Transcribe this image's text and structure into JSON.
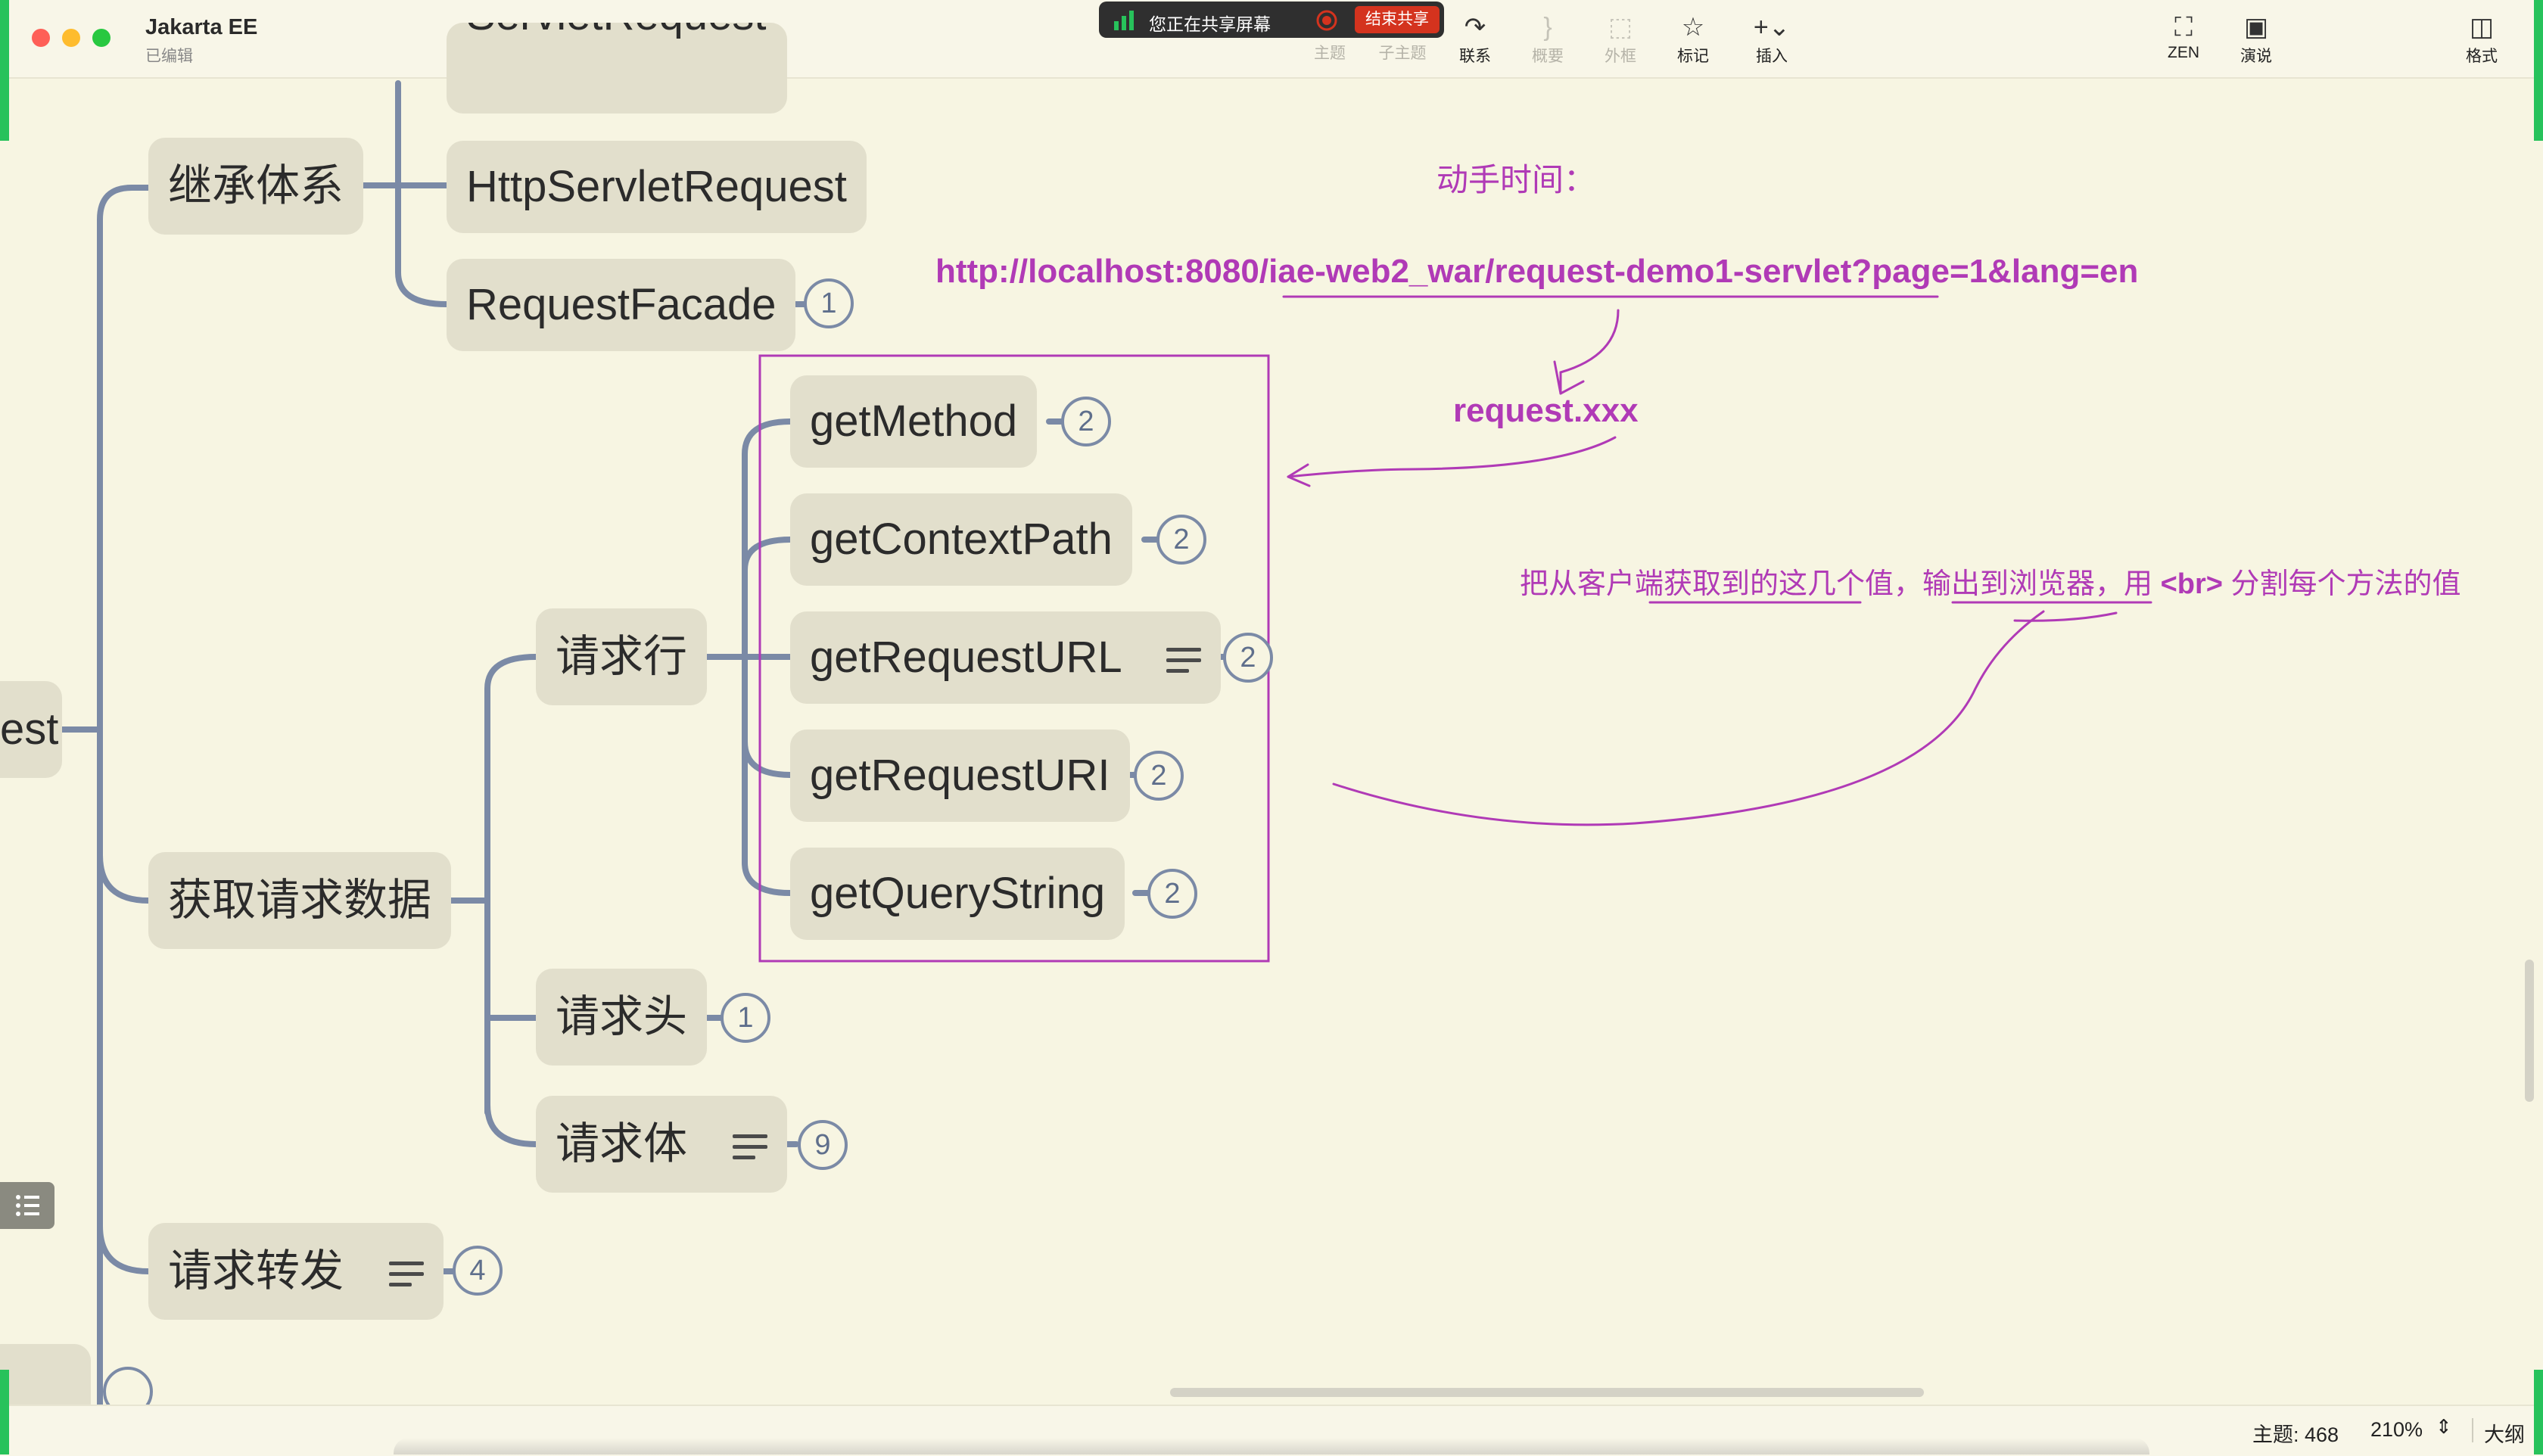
{
  "window": {
    "title": "Jakarta EE",
    "subtitle": "已编辑"
  },
  "share": {
    "text": "您正在共享屏幕",
    "end_label": "结束共享"
  },
  "toolbar": {
    "topic": "主题",
    "subtopic": "子主题",
    "relation": "联系",
    "summary": "概要",
    "boundary": "外框",
    "marker": "标记",
    "insert": "插入",
    "zen": "ZEN",
    "present": "演说",
    "format": "格式"
  },
  "mindmap": {
    "root_partial": "est",
    "partial_top": "ServletRequest",
    "inherit": {
      "label": "继承体系",
      "children": [
        {
          "label": "HttpServletRequest"
        },
        {
          "label": "RequestFacade",
          "badge": "1"
        }
      ]
    },
    "getdata": {
      "label": "获取请求数据",
      "line": {
        "label": "请求行",
        "methods": [
          {
            "label": "getMethod",
            "badge": "2"
          },
          {
            "label": "getContextPath",
            "badge": "2"
          },
          {
            "label": "getRequestURL",
            "badge": "2"
          },
          {
            "label": "getRequestURI",
            "badge": "2"
          },
          {
            "label": "getQueryString",
            "badge": "2"
          }
        ]
      },
      "header": {
        "label": "请求头",
        "badge": "1"
      },
      "body": {
        "label": "请求体",
        "badge": "9"
      }
    },
    "forward": {
      "label": "请求转发",
      "badge": "4"
    }
  },
  "annotations": {
    "hands_on": "动手时间：",
    "url": "http://localhost:8080/iae-web2_war/request-demo1-servlet?page=1&lang=en",
    "request_xxx": "request.xxx",
    "instruction_prefix": "把从客户端获取到的这几个值，输出到浏览器，用 ",
    "instruction_tag": "<br>",
    "instruction_suffix": " 分割每个方法的值"
  },
  "statusbar": {
    "topics": "主题: 468",
    "zoom": "210%",
    "outline": "大纲"
  },
  "colors": {
    "canvas": "#f7f5e2",
    "node": "#e2dfcc",
    "connector": "#7b8aa6",
    "annotation": "#b03ab6",
    "share_end": "#d4331e"
  }
}
